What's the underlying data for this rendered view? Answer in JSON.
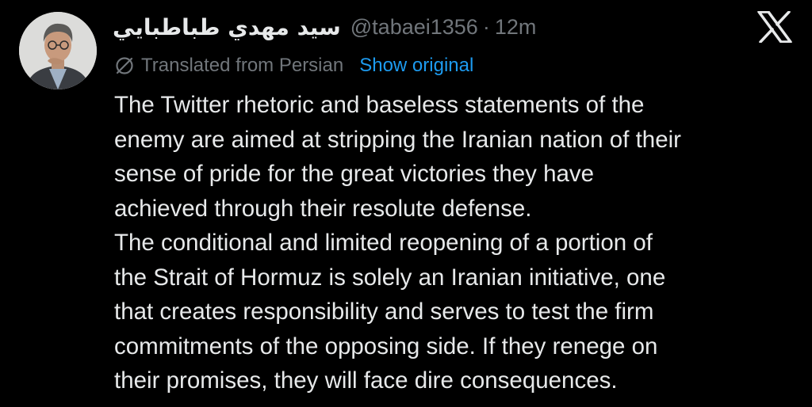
{
  "author": {
    "display_name": "سيد مهدي طباطبايي",
    "handle": "@tabaei1356",
    "separator": "·",
    "timestamp": "12m",
    "avatar_icon": "profile-photo"
  },
  "platform": {
    "logo_icon": "x-logo-icon"
  },
  "translation": {
    "icon": "translate-icon",
    "label": "Translated from Persian",
    "action_label": "Show original"
  },
  "tweet": {
    "paragraphs": [
      "The Twitter rhetoric and baseless statements of the\nenemy are aimed at stripping the Iranian nation of their\nsense of pride for the great victories they have\nachieved through their resolute defense.",
      "The conditional and limited reopening of a portion of\nthe Strait of Hormuz is solely an Iranian initiative, one\nthat creates responsibility and serves to test the firm\ncommitments of the opposing side. If they renege on\ntheir promises, they will face dire consequences."
    ]
  },
  "colors": {
    "background": "#000000",
    "primary_text": "#e7e9ea",
    "secondary_text": "#71767b",
    "link": "#1d9bf0"
  }
}
